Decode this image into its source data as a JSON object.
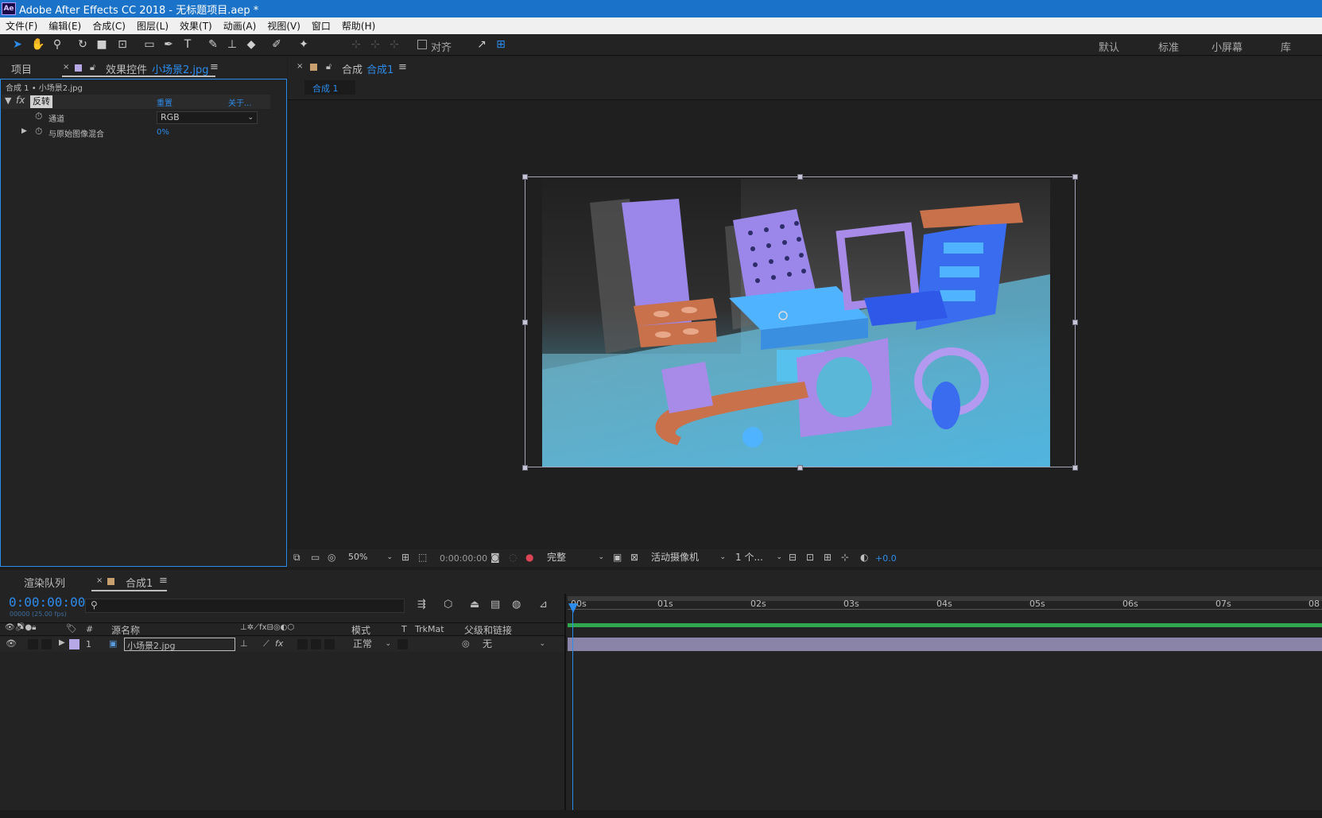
{
  "window": {
    "title": "Adobe After Effects CC 2018 - 无标题项目.aep *",
    "logo": "Ae"
  },
  "menu": [
    "文件(F)",
    "编辑(E)",
    "合成(C)",
    "图层(L)",
    "效果(T)",
    "动画(A)",
    "视图(V)",
    "窗口",
    "帮助(H)"
  ],
  "toolbar": {
    "snap_label": "对齐",
    "workspaces": [
      "默认",
      "标准",
      "小屏幕",
      "库"
    ]
  },
  "left_panel": {
    "tab_project": "项目",
    "tab_effects": "效果控件",
    "tab_effects_target": "小场景2.jpg",
    "breadcrumb": "合成 1 • 小场景2.jpg",
    "effect": {
      "fx": "fx",
      "name": "反转",
      "reset": "重置",
      "about": "关于...",
      "params": [
        {
          "label": "通道",
          "value": "RGB"
        },
        {
          "label": "与原始图像混合",
          "value": "0%"
        }
      ]
    }
  },
  "comp_panel": {
    "tab_prefix": "合成",
    "tab_name": "合成1",
    "subtab": "合成 1"
  },
  "viewer_bar": {
    "zoom": "50%",
    "timecode": "0:00:00:00",
    "resolution": "完整",
    "camera": "活动摄像机",
    "views": "1 个...",
    "exposure": "+0.0"
  },
  "timeline": {
    "tab_render_queue": "渲染队列",
    "tab_comp": "合成1",
    "current_time": "0:00:00:00",
    "frame_info": "00000 (25.00 fps)",
    "columns": {
      "index": "#",
      "source_name": "源名称",
      "mode": "模式",
      "t": "T",
      "trkmat": "TrkMat",
      "parent": "父级和链接"
    },
    "layers": [
      {
        "index": "1",
        "name": "小场景2.jpg",
        "mode": "正常",
        "parent": "无"
      }
    ],
    "ruler": [
      "00s",
      "01s",
      "02s",
      "03s",
      "04s",
      "05s",
      "06s",
      "07s",
      "08"
    ]
  },
  "colors": {
    "accent": "#2d8ceb",
    "title_bar": "#1a73c9",
    "layer_label": "#b6a7e6",
    "work_area": "#2fa84f",
    "layer_bar": "#8a84a8"
  }
}
